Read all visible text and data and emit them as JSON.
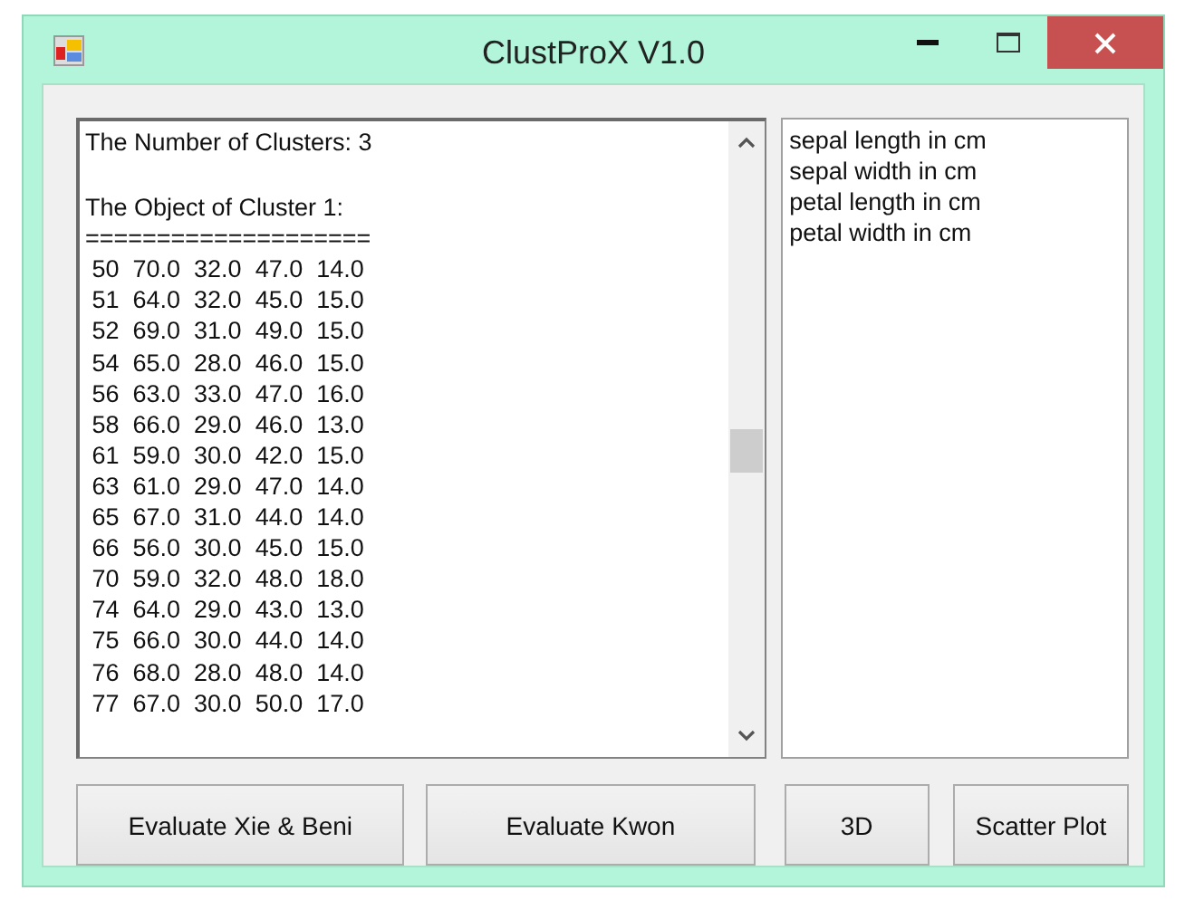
{
  "window": {
    "title": "ClustProX V1.0"
  },
  "output": {
    "summary": "The Number of Clusters: 3",
    "cluster_title": "The Object of Cluster 1:",
    "separator": "===================="
  },
  "output_lines": [
    " 50  70.0  32.0  47.0  14.0",
    " 51  64.0  32.0  45.0  15.0",
    " 52  69.0  31.0  49.0  15.0",
    " 54  65.0  28.0  46.0  15.0",
    " 56  63.0  33.0  47.0  16.0",
    " 58  66.0  29.0  46.0  13.0",
    " 61  59.0  30.0  42.0  15.0",
    " 63  61.0  29.0  47.0  14.0",
    " 65  67.0  31.0  44.0  14.0",
    " 66  56.0  30.0  45.0  15.0",
    " 70  59.0  32.0  48.0  18.0",
    " 74  64.0  29.0  43.0  13.0",
    " 75  66.0  30.0  44.0  14.0",
    " 76  68.0  28.0  48.0  14.0",
    " 77  67.0  30.0  50.0  17.0"
  ],
  "attributes": [
    "sepal length in cm",
    "sepal width in cm",
    "petal length in cm",
    "petal width in cm"
  ],
  "buttons": [
    "Evaluate Xie & Beni",
    "Evaluate Kwon",
    "3D",
    "Scatter Plot"
  ]
}
